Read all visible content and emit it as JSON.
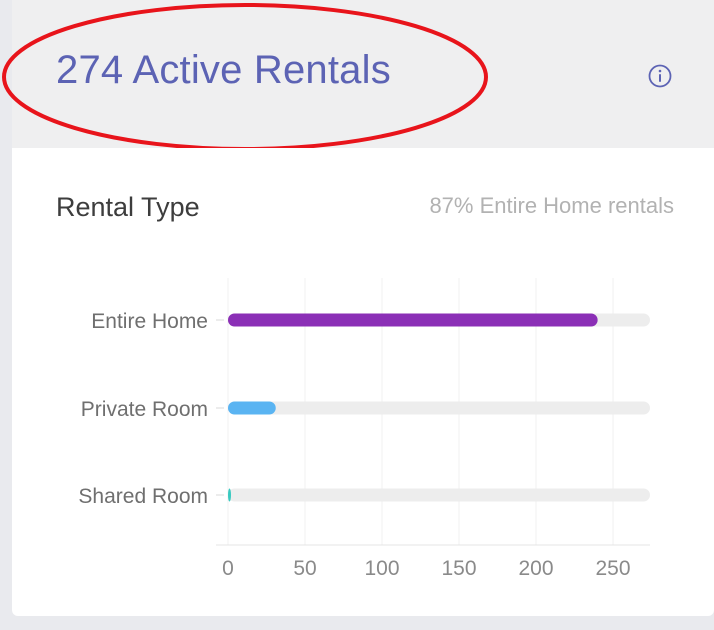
{
  "header": {
    "title": "274 Active Rentals",
    "info_icon": "info-circle-icon"
  },
  "section": {
    "title": "Rental Type",
    "note": "87% Entire Home rentals"
  },
  "colors": {
    "title": "#5c63b4",
    "highlight": "#e8141b",
    "track": "#ededed",
    "grid": "#f0f0f0"
  },
  "chart_data": {
    "type": "bar",
    "orientation": "horizontal",
    "categories": [
      "Entire Home",
      "Private Room",
      "Shared Room"
    ],
    "values": [
      240,
      31,
      1
    ],
    "colors": [
      "#8b2fb6",
      "#5ab4f2",
      "#38c9c0"
    ],
    "xlim": [
      0,
      274
    ],
    "xticks": [
      0,
      50,
      100,
      150,
      200,
      250
    ],
    "grid": true
  }
}
